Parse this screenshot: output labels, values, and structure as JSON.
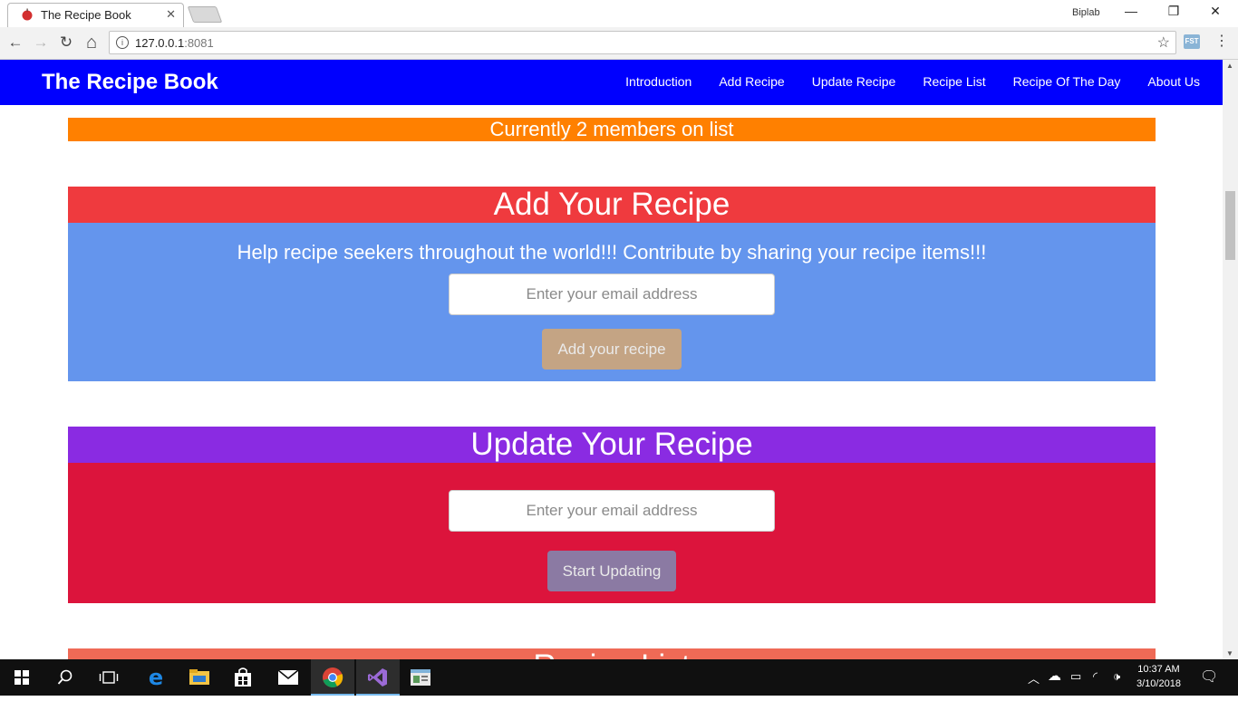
{
  "browser": {
    "tab_title": "The Recipe Book",
    "tab_close": "✕",
    "profile_name": "Biplab",
    "window_controls": {
      "minimize": "—",
      "restore": "❐",
      "close": "✕"
    },
    "url_host": "127.0.0.1",
    "url_port": ":8081",
    "nav": {
      "back": "←",
      "forward": "→",
      "reload": "↻",
      "home": "⌂"
    },
    "info_glyph": "i",
    "star": "☆",
    "extension_label": "FST",
    "menu": "⋮"
  },
  "site": {
    "brand": "The Recipe Book",
    "nav_links": [
      "Introduction",
      "Add Recipe",
      "Update Recipe",
      "Recipe List",
      "Recipe Of The Day",
      "About Us"
    ],
    "members_text": "Currently 2 members on list",
    "add_section": {
      "title": "Add Your Recipe",
      "subtitle": "Help recipe seekers throughout the world!!! Contribute by sharing your recipe items!!!",
      "email_placeholder": "Enter your email address",
      "button_label": "Add your recipe",
      "head_color": "#ef3a3e",
      "body_color": "#6495ed",
      "button_color": "#c4a484"
    },
    "update_section": {
      "title": "Update Your Recipe",
      "email_placeholder": "Enter your email address",
      "button_label": "Start Updating",
      "head_color": "#8a2be2",
      "body_color": "#dc143c",
      "button_color": "#8b7aa3"
    },
    "list_section": {
      "title": "Recipe List",
      "head_color": "#ef6a56"
    }
  },
  "taskbar": {
    "clock_time": "10:37 AM",
    "clock_date": "3/10/2018"
  }
}
